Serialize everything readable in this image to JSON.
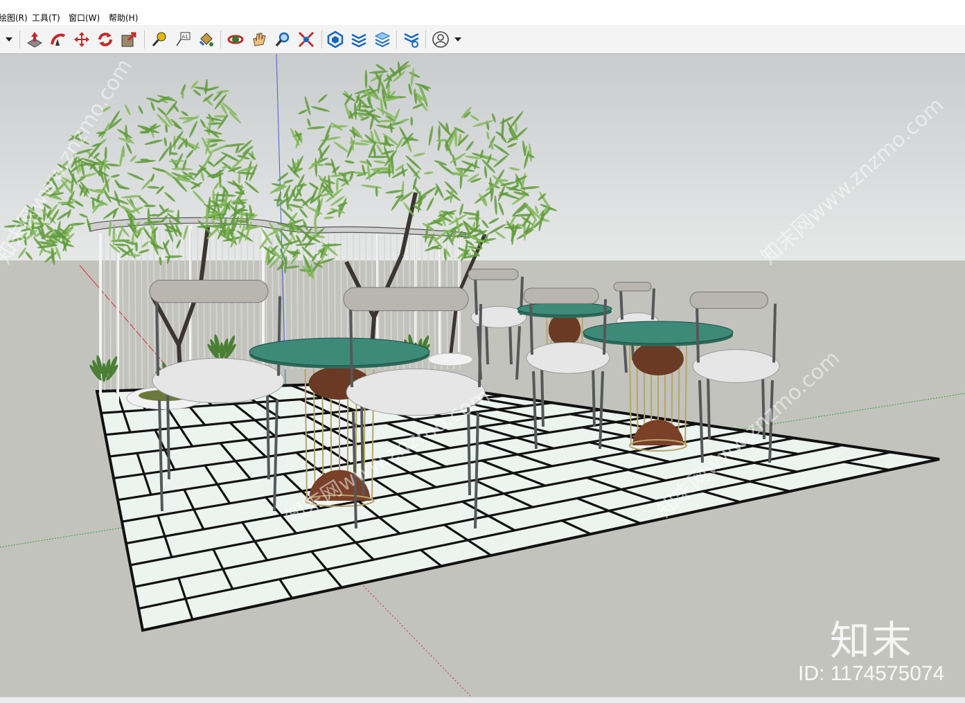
{
  "menu": {
    "items": [
      {
        "label": "绘图(R)"
      },
      {
        "label": "工具(T)"
      },
      {
        "label": "窗口(W)"
      },
      {
        "label": "帮助(H)"
      }
    ]
  },
  "toolbar": {
    "tools": [
      {
        "icon": "dropdown-arrow-icon"
      },
      {
        "icon": "push-pull-icon",
        "color": "#c62828"
      },
      {
        "icon": "follow-me-icon",
        "color": "#c62828"
      },
      {
        "icon": "move-icon",
        "color": "#c62828"
      },
      {
        "icon": "rotate-icon",
        "color": "#c62828"
      },
      {
        "icon": "scale-icon",
        "color": "#c62828"
      },
      {
        "icon": "tape-measure-icon",
        "color": "#d8a800"
      },
      {
        "icon": "text-label-icon",
        "color": "#333333"
      },
      {
        "icon": "paint-bucket-icon",
        "color": "#8a6a1a"
      },
      {
        "icon": "orbit-icon",
        "color": "#c62828"
      },
      {
        "icon": "pan-hand-icon",
        "color": "#e0a060"
      },
      {
        "icon": "zoom-icon",
        "color": "#1565c0"
      },
      {
        "icon": "zoom-extents-icon",
        "color": "#c62828"
      },
      {
        "icon": "warehouse-icon",
        "color": "#1565c0"
      },
      {
        "icon": "extension-warehouse-icon",
        "color": "#1565c0"
      },
      {
        "icon": "layers-icon",
        "color": "#1565c0"
      },
      {
        "icon": "extension-manager-icon",
        "color": "#1565c0"
      },
      {
        "icon": "user-account-icon",
        "color": "#444444"
      },
      {
        "icon": "account-dropdown-icon"
      }
    ]
  },
  "viewport": {
    "sky_color": "#d4d8d8",
    "ground_color": "#c3c3bd",
    "tile_color": "#ecf4f0",
    "table_top_color": "#3d8a78",
    "foliage_color": "#5f9b3a"
  },
  "watermark": {
    "diagonal_text": "知末网www.znzmo.com",
    "brand": "知末",
    "id_text": "ID: 1174575074"
  }
}
